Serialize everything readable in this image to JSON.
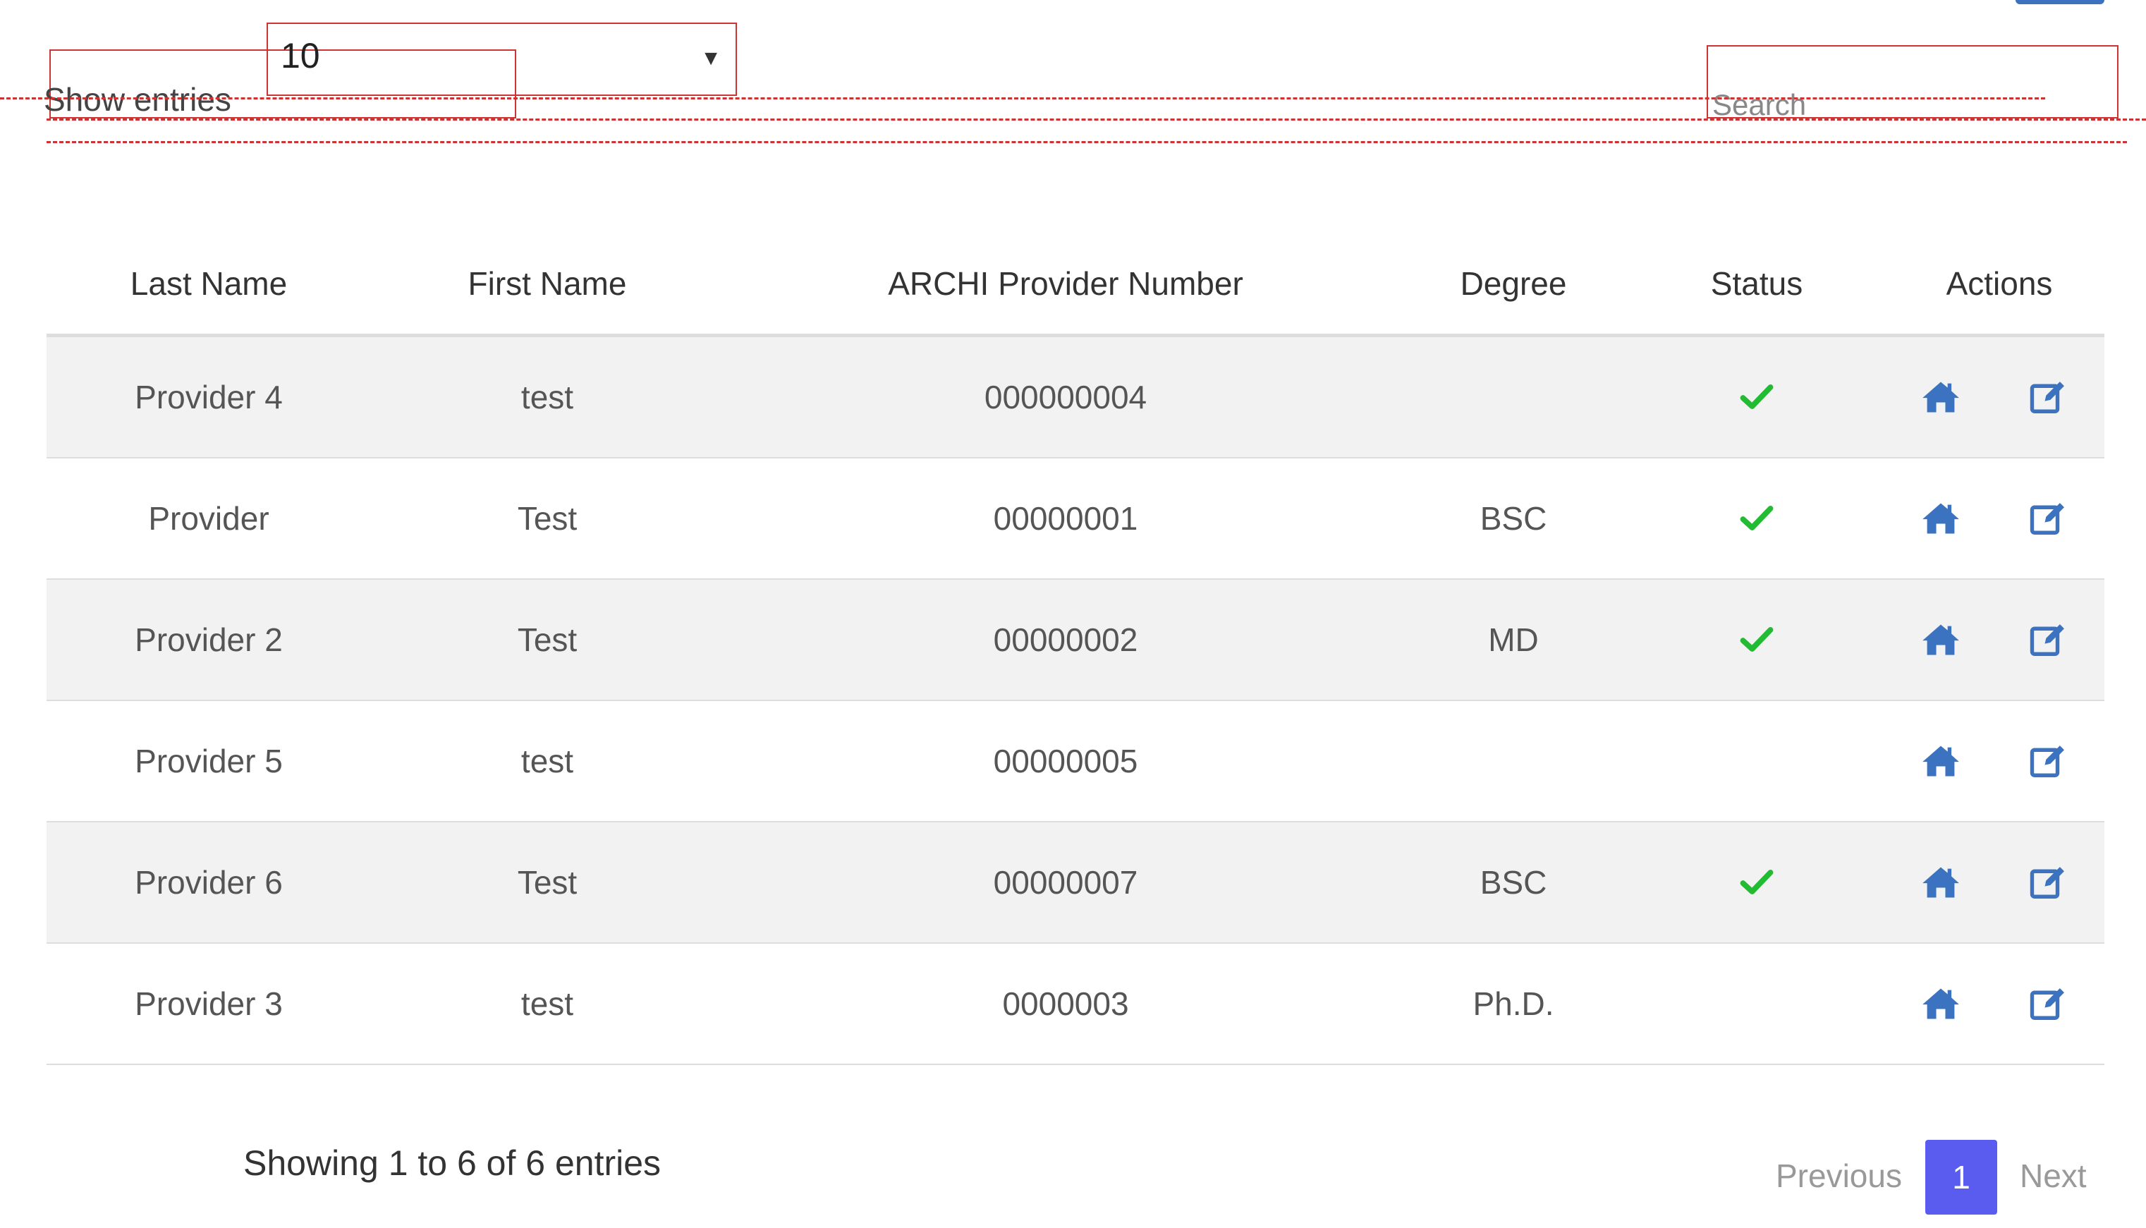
{
  "controls": {
    "length_label": "Show entries",
    "length_value": "10",
    "search_placeholder": "Search"
  },
  "table": {
    "headers": [
      "Last Name",
      "First Name",
      "ARCHI Provider Number",
      "Degree",
      "Status",
      "Actions"
    ],
    "rows": [
      {
        "last": "Provider 4",
        "first": "test",
        "number": "000000004",
        "degree": "",
        "active": true
      },
      {
        "last": "Provider",
        "first": "Test",
        "number": "00000001",
        "degree": "BSC",
        "active": true
      },
      {
        "last": "Provider 2",
        "first": "Test",
        "number": "00000002",
        "degree": "MD",
        "active": true
      },
      {
        "last": "Provider 5",
        "first": "test",
        "number": "00000005",
        "degree": "",
        "active": false
      },
      {
        "last": "Provider 6",
        "first": "Test",
        "number": "00000007",
        "degree": "BSC",
        "active": true
      },
      {
        "last": "Provider 3",
        "first": "test",
        "number": "0000003",
        "degree": "Ph.D.",
        "active": false
      }
    ],
    "icons": {
      "status": "checkmark-icon",
      "home": "home-icon",
      "edit": "edit-icon"
    }
  },
  "footer": {
    "info": "Showing 1 to 6 of 6 entries",
    "previous": "Previous",
    "current_page": "1",
    "next": "Next"
  },
  "colors": {
    "accent": "#3b73c1",
    "check": "#22bb33",
    "page_active": "#5a5cf0",
    "annotation_red": "#cc3333"
  }
}
